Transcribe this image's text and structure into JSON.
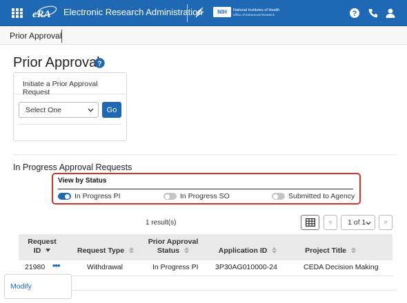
{
  "header": {
    "app_title": "Electronic Research Administration",
    "logo_text": "eRA",
    "nih_badge": "NIH",
    "nih_line1": "National Institutes of Health",
    "nih_line2": "Office of Extramural Research",
    "icons": [
      "grid-menu-icon",
      "hhs-eagle-icon",
      "help-icon",
      "phone-icon",
      "user-icon"
    ]
  },
  "tab": {
    "label": "Prior Approval"
  },
  "page": {
    "title": "Prior Approval",
    "title_icon": "help-circle-icon"
  },
  "initiate": {
    "panel_title": "Initiate a Prior Approval Request",
    "select_value": "Select One",
    "go_label": "Go"
  },
  "in_progress": {
    "section_title": "In Progress Approval Requests",
    "view_by_status": {
      "title": "View by Status",
      "toggles": [
        {
          "label": "In Progress PI",
          "on": true
        },
        {
          "label": "In Progress SO",
          "on": false
        },
        {
          "label": "Submitted to Agency",
          "on": false
        }
      ],
      "highlight_color": "#d9302c"
    }
  },
  "pagination": {
    "results": "1 result(s)",
    "prev": "«",
    "page_select": "1 of 1",
    "next": "»"
  },
  "table": {
    "columns": [
      {
        "line1": "Request",
        "line2": "ID"
      },
      {
        "line1": "",
        "line2": "Request Type"
      },
      {
        "line1": "Prior Approval",
        "line2": "Status"
      },
      {
        "line1": "",
        "line2": "Application ID"
      },
      {
        "line1": "",
        "line2": "Project Title"
      }
    ],
    "rows": [
      {
        "request_id": "21980",
        "actions": "•••",
        "request_type": "Withdrawal",
        "status": "In Progress PI",
        "application_id": "3P30AG010000-24",
        "project_title": "CEDA Decision Making"
      }
    ]
  },
  "modify": {
    "label": "Modify"
  },
  "colors": {
    "brand": "#1f69b4",
    "header_bg": "#1f69b4",
    "table_header_bg": "#e9e9e9"
  }
}
